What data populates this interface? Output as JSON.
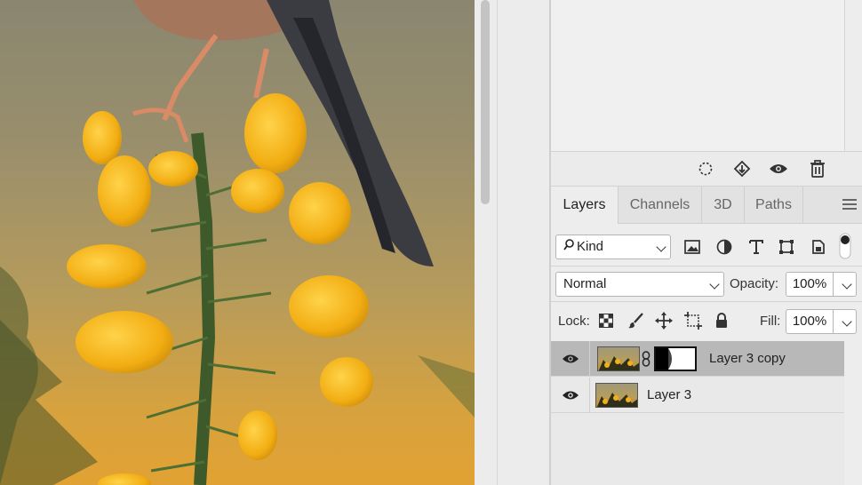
{
  "colors": {
    "panel_bg": "#ededed",
    "selected_layer": "#b8b8b8",
    "flower": "#f4b81c"
  },
  "upper_toolbar": {
    "icons": [
      "selection-dashed-icon",
      "fill-layer-icon",
      "visibility-eye-icon",
      "trash-icon"
    ]
  },
  "tabs": [
    {
      "label": "Layers",
      "active": true
    },
    {
      "label": "Channels",
      "active": false
    },
    {
      "label": "3D",
      "active": false
    },
    {
      "label": "Paths",
      "active": false
    }
  ],
  "filter": {
    "kind_label": "Kind",
    "icons": [
      "image-filter-icon",
      "adjustment-filter-icon",
      "type-filter-icon",
      "shape-filter-icon",
      "smart-object-filter-icon",
      "filter-toggle-icon"
    ]
  },
  "blend": {
    "mode": "Normal",
    "opacity_label": "Opacity:",
    "opacity_value": "100%"
  },
  "lock": {
    "label": "Lock:",
    "icons": [
      "lock-transparent-icon",
      "lock-paint-icon",
      "lock-position-icon",
      "lock-artboard-icon",
      "lock-all-icon"
    ],
    "fill_label": "Fill:",
    "fill_value": "100%"
  },
  "layers": [
    {
      "name": "Layer 3 copy",
      "visible": true,
      "selected": true,
      "has_mask": true
    },
    {
      "name": "Layer 3",
      "visible": true,
      "selected": false,
      "has_mask": false
    }
  ]
}
